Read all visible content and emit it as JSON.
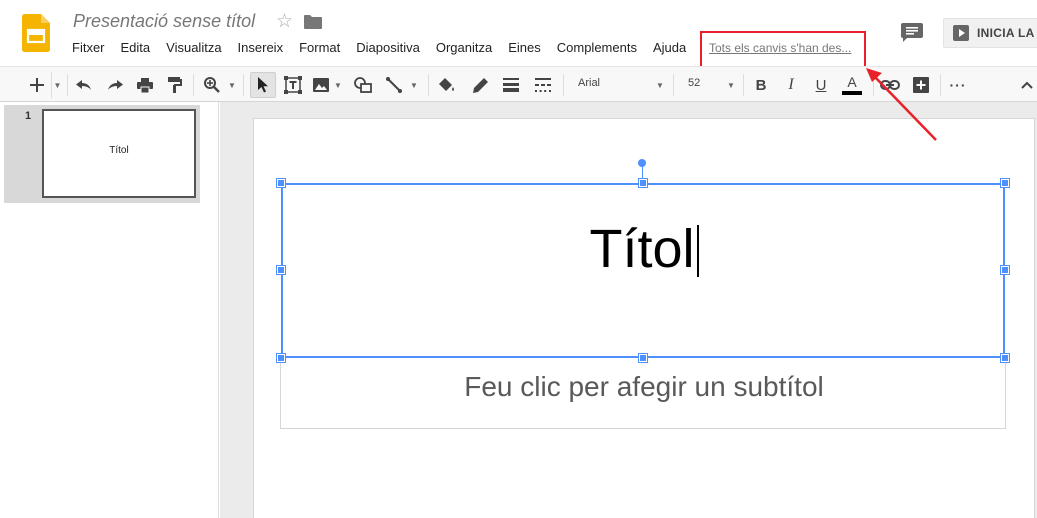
{
  "app": {
    "doc_title": "Presentació sense títol",
    "save_status": "Tots els canvis s'han des...",
    "present_label": "INICIA LA"
  },
  "menu": [
    "Fitxer",
    "Edita",
    "Visualitza",
    "Insereix",
    "Format",
    "Diapositiva",
    "Organitza",
    "Eines",
    "Complements",
    "Ajuda"
  ],
  "toolbar": {
    "font_name": "Arial",
    "font_size": "52"
  },
  "icons": [
    "slides-logo-icon",
    "star-icon",
    "folder-icon",
    "comments-icon",
    "present-icon",
    "add-icon",
    "undo-icon",
    "redo-icon",
    "print-icon",
    "paint-format-icon",
    "zoom-icon",
    "select-icon",
    "textbox-icon",
    "image-icon",
    "shape-icon",
    "line-icon",
    "fill-color-icon",
    "border-color-icon",
    "border-weight-icon",
    "border-dash-icon",
    "bold-icon",
    "italic-icon",
    "underline-icon",
    "text-color-icon",
    "link-icon",
    "comment-add-icon",
    "more-icon",
    "collapse-icon"
  ],
  "filmstrip": {
    "slides": [
      {
        "number": "1",
        "title": "Títol"
      }
    ]
  },
  "slide": {
    "title": "Títol",
    "subtitle_placeholder": "Feu clic per afegir un subtítol"
  },
  "colors": {
    "selection": "#4d90fe",
    "highlight": "#e8202a",
    "logo": "#f4b400"
  }
}
